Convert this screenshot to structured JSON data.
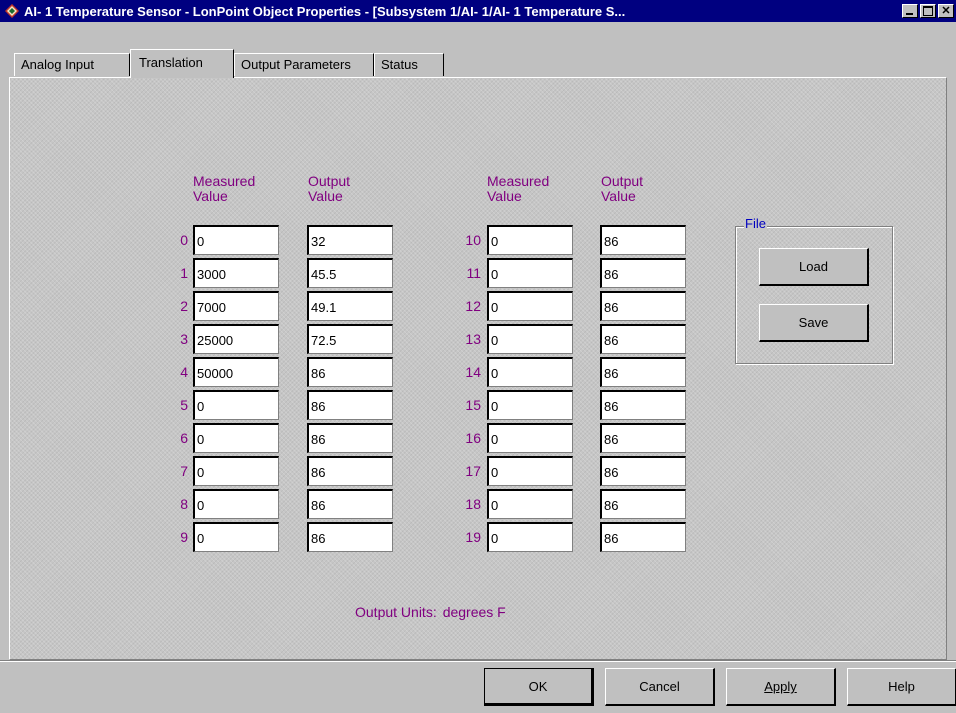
{
  "window": {
    "title": "AI- 1 Temperature Sensor - LonPoint Object Properties - [Subsystem 1/AI- 1/AI- 1 Temperature S..."
  },
  "tabs": [
    {
      "label": "Analog Input",
      "active": false
    },
    {
      "label": "Translation",
      "active": true
    },
    {
      "label": "Output Parameters",
      "active": false
    },
    {
      "label": "Status",
      "active": false
    }
  ],
  "headers": {
    "measured_line1": "Measured",
    "measured_line2": "Value",
    "output_line1": "Output",
    "output_line2": "Value"
  },
  "table_left": [
    {
      "index": "0",
      "measured": "0",
      "output": "32"
    },
    {
      "index": "1",
      "measured": "3000",
      "output": "45.5"
    },
    {
      "index": "2",
      "measured": "7000",
      "output": "49.1"
    },
    {
      "index": "3",
      "measured": "25000",
      "output": "72.5"
    },
    {
      "index": "4",
      "measured": "50000",
      "output": "86"
    },
    {
      "index": "5",
      "measured": "0",
      "output": "86"
    },
    {
      "index": "6",
      "measured": "0",
      "output": "86"
    },
    {
      "index": "7",
      "measured": "0",
      "output": "86"
    },
    {
      "index": "8",
      "measured": "0",
      "output": "86"
    },
    {
      "index": "9",
      "measured": "0",
      "output": "86"
    }
  ],
  "table_right": [
    {
      "index": "10",
      "measured": "0",
      "output": "86"
    },
    {
      "index": "11",
      "measured": "0",
      "output": "86"
    },
    {
      "index": "12",
      "measured": "0",
      "output": "86"
    },
    {
      "index": "13",
      "measured": "0",
      "output": "86"
    },
    {
      "index": "14",
      "measured": "0",
      "output": "86"
    },
    {
      "index": "15",
      "measured": "0",
      "output": "86"
    },
    {
      "index": "16",
      "measured": "0",
      "output": "86"
    },
    {
      "index": "17",
      "measured": "0",
      "output": "86"
    },
    {
      "index": "18",
      "measured": "0",
      "output": "86"
    },
    {
      "index": "19",
      "measured": "0",
      "output": "86"
    }
  ],
  "file_group": {
    "label": "File",
    "load_label": "Load",
    "save_label": "Save"
  },
  "output_units": {
    "label": "Output Units:",
    "value": "degrees F"
  },
  "dialog_buttons": {
    "ok": "OK",
    "cancel": "Cancel",
    "apply": "Apply",
    "help": "Help"
  },
  "colors": {
    "titlebar": "#000080",
    "label_purple": "#800080",
    "group_label_blue": "#0000c0",
    "face": "#c0c0c0"
  },
  "icons": [
    "app-icon",
    "minimize-icon",
    "maximize-icon",
    "close-icon"
  ]
}
